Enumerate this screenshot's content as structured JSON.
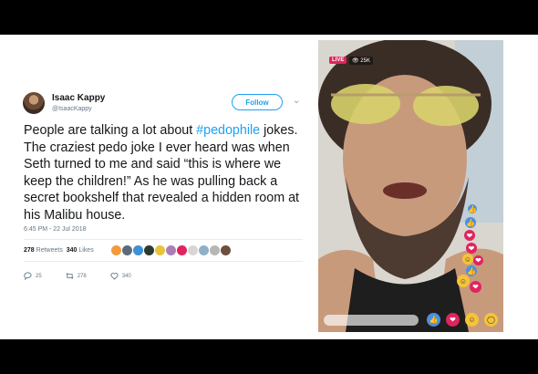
{
  "tweet": {
    "name": "Isaac Kappy",
    "handle": "@IsaacKappy",
    "follow_label": "Follow",
    "text_before": "People are talking a lot about ",
    "hashtag": "#pedophile",
    "text_after": " jokes. The craziest pedo joke I ever heard was when Seth turned to me and said “this is where we keep the children!” As he was pulling back a secret bookshelf that revealed a hidden room at his Malibu house.",
    "timestamp": "6:45 PM - 22 Jul 2018",
    "retweets_count": "278",
    "retweets_label": "Retweets",
    "likes_count": "340",
    "likes_label": "Likes",
    "actions": {
      "reply": "25",
      "retweet": "278",
      "like": "340"
    }
  },
  "video": {
    "live_label": "LIVE",
    "viewers": "25K"
  },
  "colors": {
    "twitter_blue": "#1da1f2",
    "live_red": "#e0245e"
  }
}
